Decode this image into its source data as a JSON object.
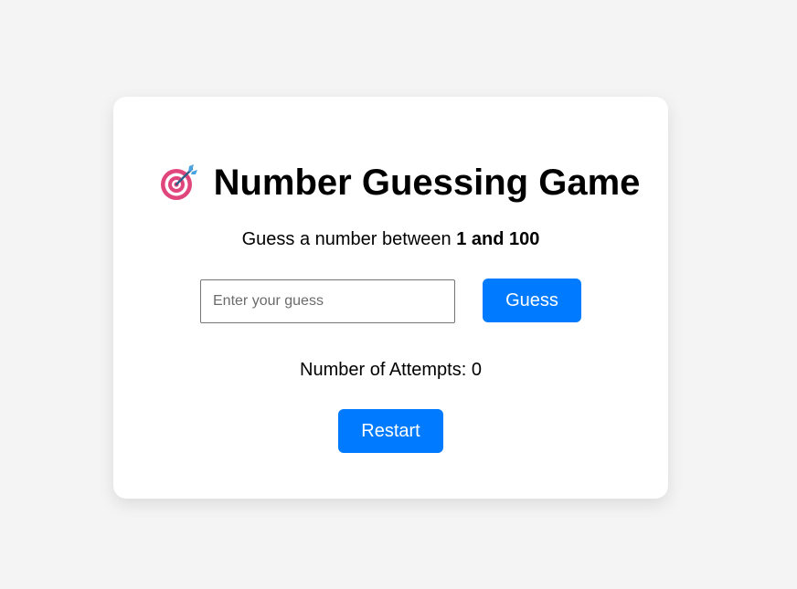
{
  "game": {
    "title": "Number Guessing Game",
    "title_icon": "direct-hit-target-icon",
    "instruction_prefix": "Guess a number between ",
    "instruction_range": "1 and 100",
    "guess_input": {
      "value": "",
      "placeholder": "Enter your guess"
    },
    "guess_button_label": "Guess",
    "attempts_label": "Number of Attempts: ",
    "attempts_count": "0",
    "restart_button_label": "Restart"
  },
  "colors": {
    "page_background": "#f4f4f4",
    "card_background": "#ffffff",
    "button_primary": "#007bff",
    "button_text": "#ffffff",
    "target_ring_outer": "#e0457b",
    "target_ring_inner": "#ffffff",
    "dart_blue": "#4aa3e0"
  }
}
